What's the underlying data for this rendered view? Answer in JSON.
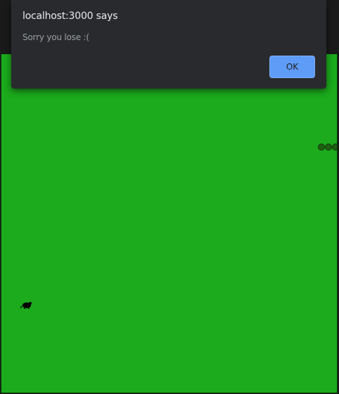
{
  "dialog": {
    "title": "localhost:3000 says",
    "message": "Sorry you lose :(",
    "ok_label": "OK"
  },
  "game": {
    "board_color": "#1bab1c",
    "snake_color": "#1f5f12",
    "snake_segments_visible": 3,
    "food_icon": "mouse-icon"
  },
  "colors": {
    "dialog_bg": "#292a2d",
    "button_bg": "#5f9cf8",
    "page_bg": "#1a1a1b"
  }
}
